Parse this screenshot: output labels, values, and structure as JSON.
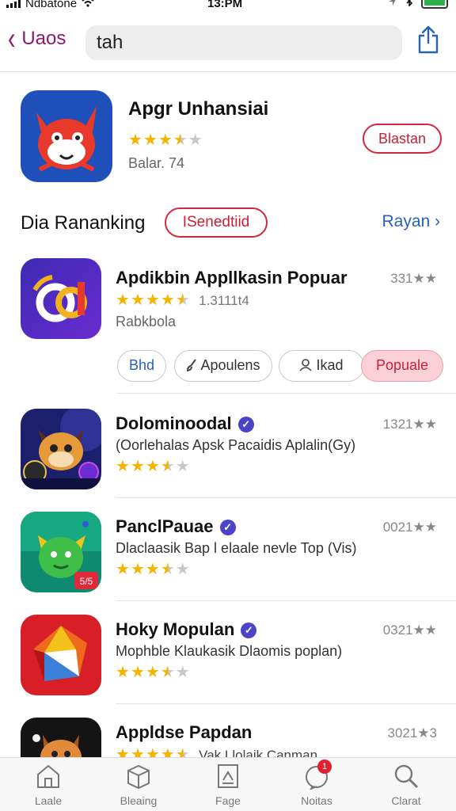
{
  "status_bar": {
    "carrier": "Ndbatone",
    "time": "13:PM",
    "battery_color": "#2bb34a"
  },
  "nav": {
    "back_label": "Uaos",
    "search_value": "tah"
  },
  "featured": {
    "name": "Apgr Unhansiai",
    "rating": 3.5,
    "sub": "Balar. 74",
    "action": "Blastan"
  },
  "section": {
    "title": "Dia Rananking",
    "chip": "ISenedtiid",
    "more": "Rayan"
  },
  "apps": [
    {
      "name": "Apdikbin Appllkasin Popuar",
      "rating": 4.5,
      "rating_text": "1.3111t4",
      "desc": "Rabkbola",
      "count": "331★★",
      "verified": false
    },
    {
      "name": "Dolominoodal",
      "rating": 3.5,
      "desc": "(Oorlehalas Apsk Pacaidis Aplalin(Gy)",
      "count": "1321★★",
      "verified": true
    },
    {
      "name": "PanclPauae",
      "rating": 3.5,
      "desc": "Dlaclaasik Bap l elaale nevle Top (Vis)",
      "count": "0021★★",
      "verified": true
    },
    {
      "name": "Hoky Mopulan",
      "rating": 3.5,
      "desc": "Mophble Klaukasik Dlaomis poplan)",
      "count": "0321★★",
      "verified": true
    },
    {
      "name": "Appldse Papdan",
      "rating": 4.5,
      "desc": "Vak Llolaik Canman",
      "count": "3021★3",
      "verified": false
    }
  ],
  "filters": [
    {
      "label": "Bhd",
      "icon": ""
    },
    {
      "label": "Apoulens",
      "icon": "brush-icon"
    },
    {
      "label": "Ikad",
      "icon": "person-icon"
    },
    {
      "label": "Popuale",
      "icon": ""
    }
  ],
  "tabs": [
    {
      "label": "Laale",
      "icon": "home-icon"
    },
    {
      "label": "Bleaing",
      "icon": "box-icon"
    },
    {
      "label": "Fage",
      "icon": "document-icon"
    },
    {
      "label": "Noitas",
      "icon": "notification-icon",
      "badge": "1"
    },
    {
      "label": "Clarat",
      "icon": "search-icon"
    }
  ],
  "colors": {
    "accent_red": "#d2283f",
    "link_blue": "#2762b7",
    "back_purple": "#8c1a6a",
    "star": "#f5b400"
  }
}
